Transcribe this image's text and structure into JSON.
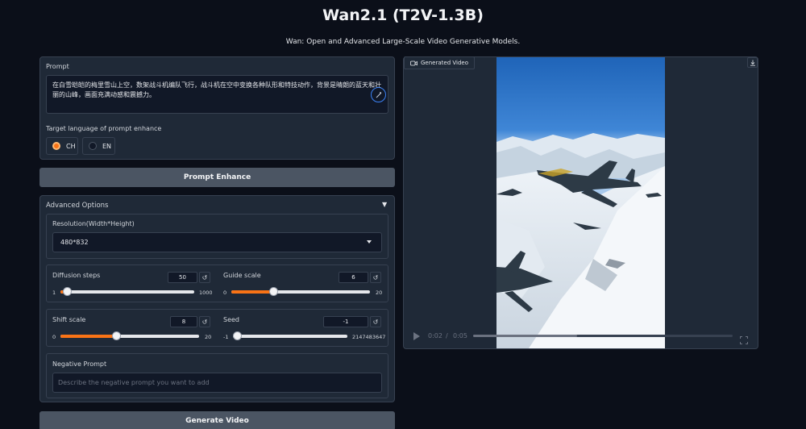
{
  "header": {
    "title": "Wan2.1 (T2V-1.3B)",
    "subtitle": "Wan: Open and Advanced Large-Scale Video Generative Models."
  },
  "prompt": {
    "label": "Prompt",
    "value": "在白雪皑皑的梅里雪山上空，数架战斗机编队飞行，战斗机在空中变换各种队形和特技动作，背景是晴朗的蓝天和壮丽的山峰，画面充满动感和震撼力。"
  },
  "enhance_lang": {
    "label": "Target language of prompt enhance",
    "options": [
      "CH",
      "EN"
    ],
    "selected": "CH"
  },
  "prompt_enhance_button": "Prompt Enhance",
  "advanced": {
    "title": "Advanced Options",
    "toggle_glyph": "▼",
    "resolution": {
      "label": "Resolution(Width*Height)",
      "value": "480*832"
    },
    "diffusion_steps": {
      "label": "Diffusion steps",
      "value": "50",
      "min": "1",
      "max": "1000",
      "fraction": 0.049
    },
    "guide_scale": {
      "label": "Guide scale",
      "value": "6",
      "min": "0",
      "max": "20",
      "fraction": 0.3
    },
    "shift_scale": {
      "label": "Shift scale",
      "value": "8",
      "min": "0",
      "max": "20",
      "fraction": 0.4
    },
    "seed": {
      "label": "Seed",
      "value": "-1",
      "min": "-1",
      "max": "2147483647",
      "fraction": 0.0
    },
    "negative_prompt": {
      "label": "Negative Prompt",
      "placeholder": "Describe the negative prompt you want to add"
    }
  },
  "generate_button": "Generate Video",
  "video": {
    "tag": "Generated Video",
    "time_current": "0:02",
    "time_sep": "/",
    "time_total": "0:05",
    "progress": 0.4
  },
  "colors": {
    "accent": "#f97316",
    "background": "#0b0f19",
    "panel": "#1f2937"
  }
}
